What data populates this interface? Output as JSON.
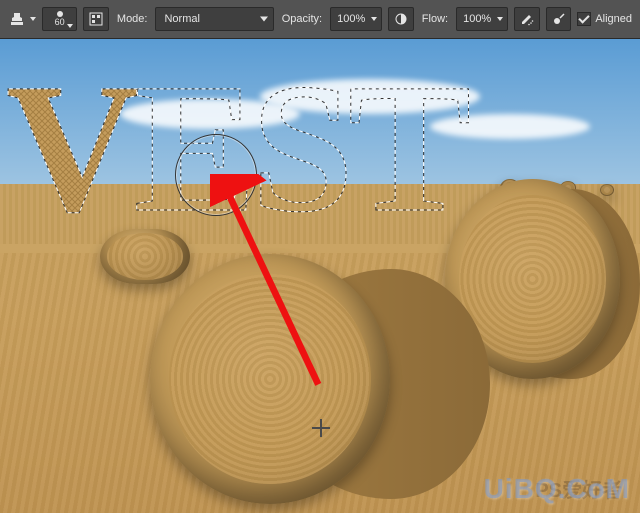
{
  "toolbar": {
    "brush_size": "60",
    "mode_label": "Mode:",
    "mode_value": "Normal",
    "opacity_label": "Opacity:",
    "opacity_value": "100%",
    "flow_label": "Flow:",
    "flow_value": "100%",
    "aligned_label": "Aligned",
    "aligned_checked": true
  },
  "canvas": {
    "text_effect": "VEST",
    "letters": [
      "V",
      "E",
      "S",
      "T"
    ]
  },
  "watermark": {
    "line1": "PS爱好者",
    "line2": "UiBQ.CoM"
  },
  "icons": {
    "stamp": "stamp-icon",
    "brush_panel": "brush-panel-icon",
    "pressure_opacity": "pressure-opacity-icon",
    "airbrush": "airbrush-icon",
    "pressure_size": "pressure-size-icon"
  }
}
